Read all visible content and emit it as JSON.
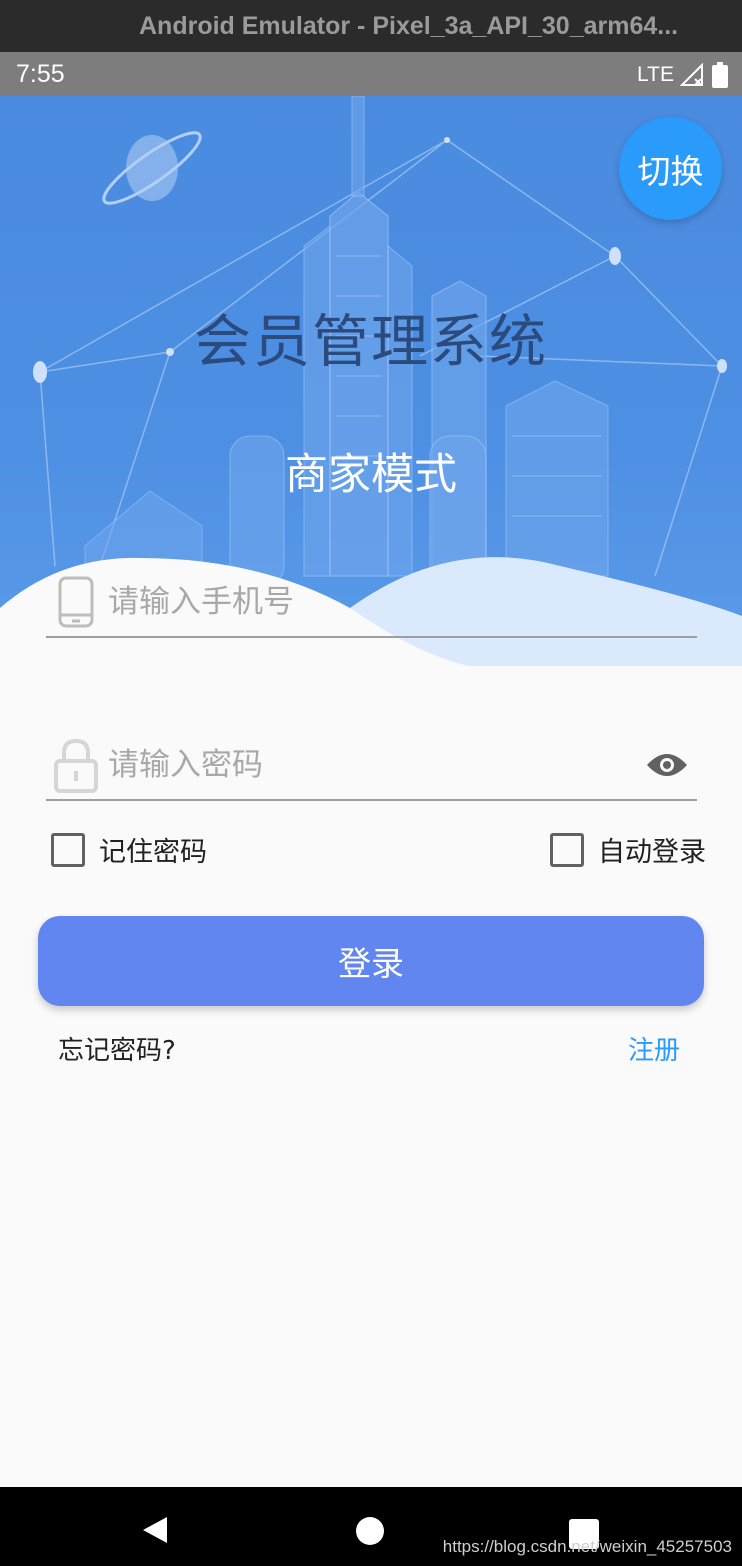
{
  "window": {
    "title": "Android Emulator - Pixel_3a_API_30_arm64..."
  },
  "status_bar": {
    "time": "7:55",
    "network": "LTE",
    "icons": [
      "signal-icon",
      "battery-icon"
    ]
  },
  "header": {
    "switch_label": "切换",
    "app_title": "会员管理系统",
    "mode": "商家模式"
  },
  "form": {
    "phone": {
      "placeholder": "请输入手机号",
      "value": "",
      "icon": "phone-icon"
    },
    "password": {
      "placeholder": "请输入密码",
      "value": "",
      "icon": "lock-icon",
      "toggle_icon": "eye-icon"
    },
    "remember_password": {
      "label": "记住密码",
      "checked": false
    },
    "auto_login": {
      "label": "自动登录",
      "checked": false
    },
    "login_label": "登录",
    "forgot_label": "忘记密码?",
    "register_label": "注册"
  },
  "nav_bar": {
    "icons": [
      "back-icon",
      "home-icon",
      "recents-icon"
    ]
  },
  "watermark": "https://blog.csdn.net/weixin_45257503",
  "colors": {
    "hero_blue": "#4a8be0",
    "accent": "#2a9bfb",
    "button": "#6186f0",
    "title_text": "#2b4a7e"
  }
}
